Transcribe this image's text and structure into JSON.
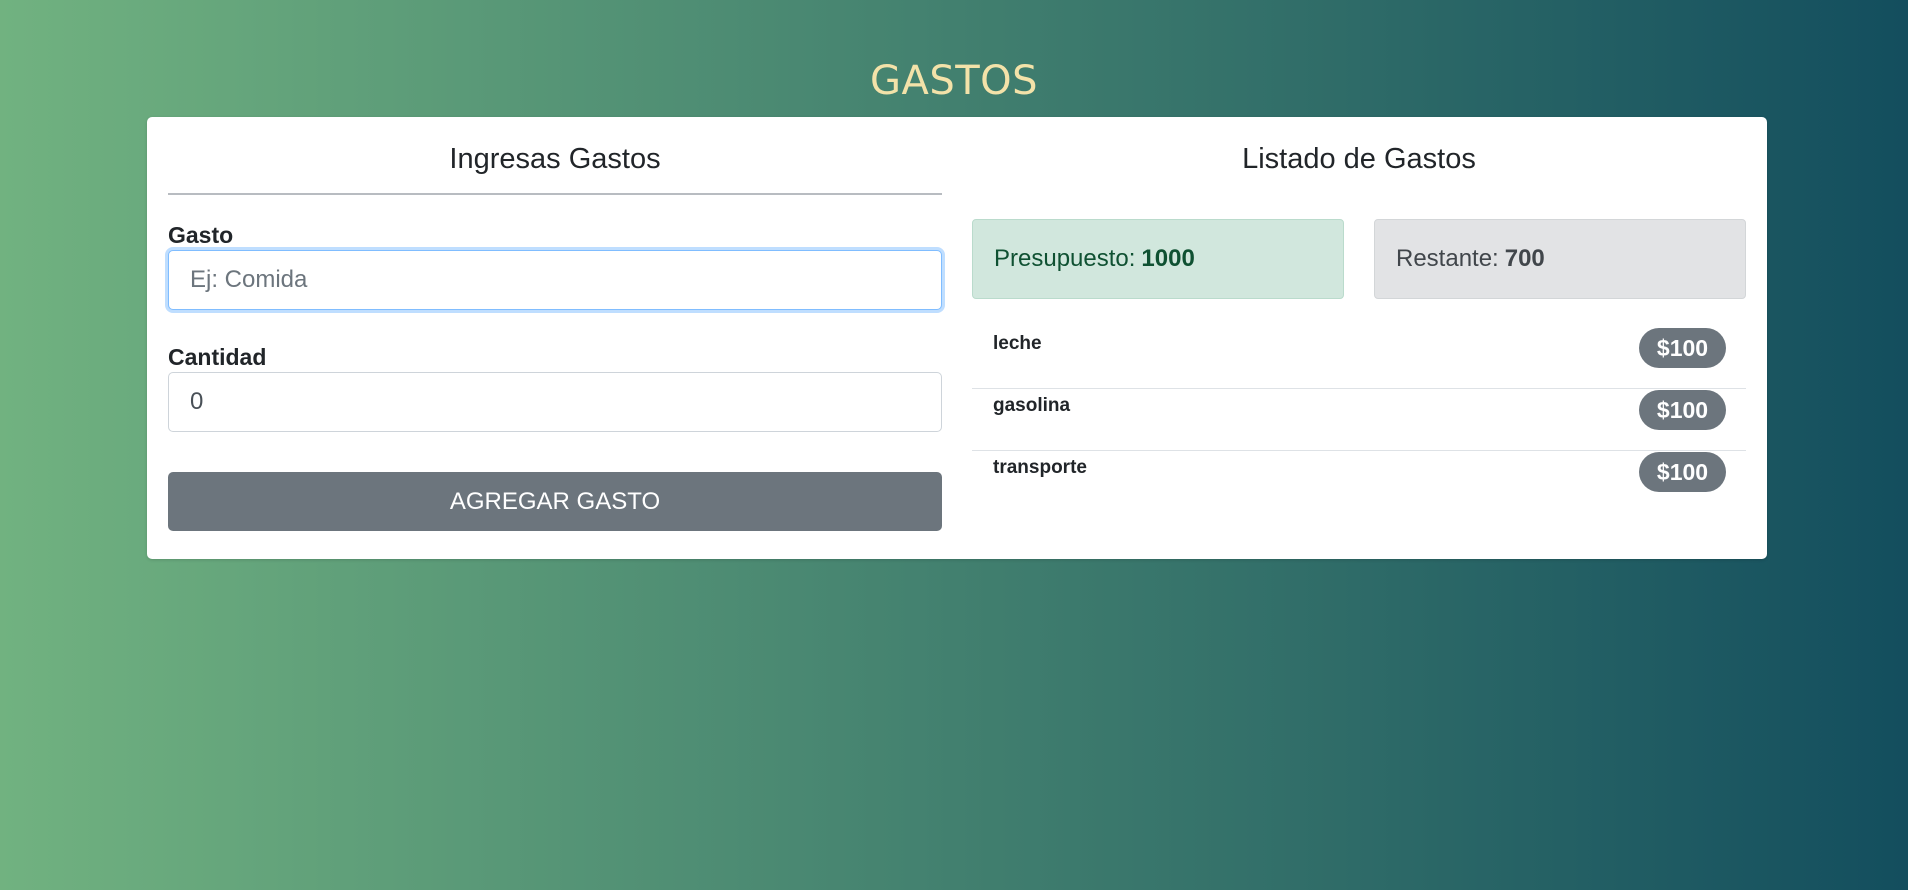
{
  "page": {
    "title": "GASTOS"
  },
  "form": {
    "heading": "Ingresas Gastos",
    "expense_label": "Gasto",
    "expense_placeholder": "Ej: Comida",
    "expense_value": "",
    "amount_label": "Cantidad",
    "amount_value": "0",
    "submit_label": "AGREGAR GASTO"
  },
  "listing": {
    "heading": "Listado de Gastos",
    "budget": {
      "label": "Presupuesto:",
      "value": "1000"
    },
    "remaining": {
      "label": "Restante:",
      "value": "700"
    },
    "expenses": [
      {
        "name": "leche",
        "amount": "$100"
      },
      {
        "name": "gasolina",
        "amount": "$100"
      },
      {
        "name": "transporte",
        "amount": "$100"
      }
    ]
  },
  "colors": {
    "gradient_start": "#71b280",
    "gradient_end": "#134e5e",
    "title": "#f3e2a9",
    "button": "#6c757d",
    "badge": "#6c757d",
    "budget_bg": "#d1e7dd",
    "remaining_bg": "#e2e3e5"
  }
}
